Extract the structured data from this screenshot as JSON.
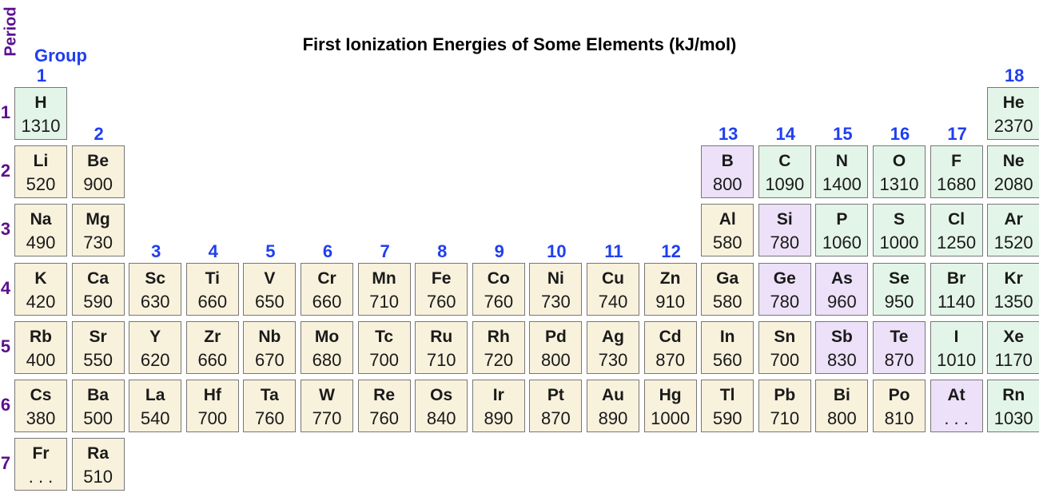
{
  "title": "First Ionization Energies of Some Elements (kJ/mol)",
  "period_label": "Period",
  "group_label": "Group",
  "colors": {
    "metal": "#f8f1dc",
    "nonmetal": "#e3f5e8",
    "metalloid": "#ece1f8",
    "group_number": "#1f3ff0",
    "period_number": "#5b0f8f"
  },
  "groups": [
    {
      "label": "1",
      "col": 1,
      "row": 1
    },
    {
      "label": "2",
      "col": 2,
      "row": 2
    },
    {
      "label": "3",
      "col": 3,
      "row": 4
    },
    {
      "label": "4",
      "col": 4,
      "row": 4
    },
    {
      "label": "5",
      "col": 5,
      "row": 4
    },
    {
      "label": "6",
      "col": 6,
      "row": 4
    },
    {
      "label": "7",
      "col": 7,
      "row": 4
    },
    {
      "label": "8",
      "col": 8,
      "row": 4
    },
    {
      "label": "9",
      "col": 9,
      "row": 4
    },
    {
      "label": "10",
      "col": 10,
      "row": 4
    },
    {
      "label": "11",
      "col": 11,
      "row": 4
    },
    {
      "label": "12",
      "col": 12,
      "row": 4
    },
    {
      "label": "13",
      "col": 13,
      "row": 2
    },
    {
      "label": "14",
      "col": 14,
      "row": 2
    },
    {
      "label": "15",
      "col": 15,
      "row": 2
    },
    {
      "label": "16",
      "col": 16,
      "row": 2
    },
    {
      "label": "17",
      "col": 17,
      "row": 2
    },
    {
      "label": "18",
      "col": 18,
      "row": 1
    }
  ],
  "periods": [
    "1",
    "2",
    "3",
    "4",
    "5",
    "6",
    "7"
  ],
  "elements": [
    {
      "symbol": "H",
      "value": "1310",
      "period": 1,
      "col": 1,
      "type": "nonmetal"
    },
    {
      "symbol": "He",
      "value": "2370",
      "period": 1,
      "col": 18,
      "type": "nonmetal"
    },
    {
      "symbol": "Li",
      "value": "520",
      "period": 2,
      "col": 1,
      "type": "metal"
    },
    {
      "symbol": "Be",
      "value": "900",
      "period": 2,
      "col": 2,
      "type": "metal"
    },
    {
      "symbol": "B",
      "value": "800",
      "period": 2,
      "col": 13,
      "type": "metalloid"
    },
    {
      "symbol": "C",
      "value": "1090",
      "period": 2,
      "col": 14,
      "type": "nonmetal"
    },
    {
      "symbol": "N",
      "value": "1400",
      "period": 2,
      "col": 15,
      "type": "nonmetal"
    },
    {
      "symbol": "O",
      "value": "1310",
      "period": 2,
      "col": 16,
      "type": "nonmetal"
    },
    {
      "symbol": "F",
      "value": "1680",
      "period": 2,
      "col": 17,
      "type": "nonmetal"
    },
    {
      "symbol": "Ne",
      "value": "2080",
      "period": 2,
      "col": 18,
      "type": "nonmetal"
    },
    {
      "symbol": "Na",
      "value": "490",
      "period": 3,
      "col": 1,
      "type": "metal"
    },
    {
      "symbol": "Mg",
      "value": "730",
      "period": 3,
      "col": 2,
      "type": "metal"
    },
    {
      "symbol": "Al",
      "value": "580",
      "period": 3,
      "col": 13,
      "type": "metal"
    },
    {
      "symbol": "Si",
      "value": "780",
      "period": 3,
      "col": 14,
      "type": "metalloid"
    },
    {
      "symbol": "P",
      "value": "1060",
      "period": 3,
      "col": 15,
      "type": "nonmetal"
    },
    {
      "symbol": "S",
      "value": "1000",
      "period": 3,
      "col": 16,
      "type": "nonmetal"
    },
    {
      "symbol": "Cl",
      "value": "1250",
      "period": 3,
      "col": 17,
      "type": "nonmetal"
    },
    {
      "symbol": "Ar",
      "value": "1520",
      "period": 3,
      "col": 18,
      "type": "nonmetal"
    },
    {
      "symbol": "K",
      "value": "420",
      "period": 4,
      "col": 1,
      "type": "metal"
    },
    {
      "symbol": "Ca",
      "value": "590",
      "period": 4,
      "col": 2,
      "type": "metal"
    },
    {
      "symbol": "Sc",
      "value": "630",
      "period": 4,
      "col": 3,
      "type": "metal"
    },
    {
      "symbol": "Ti",
      "value": "660",
      "period": 4,
      "col": 4,
      "type": "metal"
    },
    {
      "symbol": "V",
      "value": "650",
      "period": 4,
      "col": 5,
      "type": "metal"
    },
    {
      "symbol": "Cr",
      "value": "660",
      "period": 4,
      "col": 6,
      "type": "metal"
    },
    {
      "symbol": "Mn",
      "value": "710",
      "period": 4,
      "col": 7,
      "type": "metal"
    },
    {
      "symbol": "Fe",
      "value": "760",
      "period": 4,
      "col": 8,
      "type": "metal"
    },
    {
      "symbol": "Co",
      "value": "760",
      "period": 4,
      "col": 9,
      "type": "metal"
    },
    {
      "symbol": "Ni",
      "value": "730",
      "period": 4,
      "col": 10,
      "type": "metal"
    },
    {
      "symbol": "Cu",
      "value": "740",
      "period": 4,
      "col": 11,
      "type": "metal"
    },
    {
      "symbol": "Zn",
      "value": "910",
      "period": 4,
      "col": 12,
      "type": "metal"
    },
    {
      "symbol": "Ga",
      "value": "580",
      "period": 4,
      "col": 13,
      "type": "metal"
    },
    {
      "symbol": "Ge",
      "value": "780",
      "period": 4,
      "col": 14,
      "type": "metalloid"
    },
    {
      "symbol": "As",
      "value": "960",
      "period": 4,
      "col": 15,
      "type": "metalloid"
    },
    {
      "symbol": "Se",
      "value": "950",
      "period": 4,
      "col": 16,
      "type": "nonmetal"
    },
    {
      "symbol": "Br",
      "value": "1140",
      "period": 4,
      "col": 17,
      "type": "nonmetal"
    },
    {
      "symbol": "Kr",
      "value": "1350",
      "period": 4,
      "col": 18,
      "type": "nonmetal"
    },
    {
      "symbol": "Rb",
      "value": "400",
      "period": 5,
      "col": 1,
      "type": "metal"
    },
    {
      "symbol": "Sr",
      "value": "550",
      "period": 5,
      "col": 2,
      "type": "metal"
    },
    {
      "symbol": "Y",
      "value": "620",
      "period": 5,
      "col": 3,
      "type": "metal"
    },
    {
      "symbol": "Zr",
      "value": "660",
      "period": 5,
      "col": 4,
      "type": "metal"
    },
    {
      "symbol": "Nb",
      "value": "670",
      "period": 5,
      "col": 5,
      "type": "metal"
    },
    {
      "symbol": "Mo",
      "value": "680",
      "period": 5,
      "col": 6,
      "type": "metal"
    },
    {
      "symbol": "Tc",
      "value": "700",
      "period": 5,
      "col": 7,
      "type": "metal"
    },
    {
      "symbol": "Ru",
      "value": "710",
      "period": 5,
      "col": 8,
      "type": "metal"
    },
    {
      "symbol": "Rh",
      "value": "720",
      "period": 5,
      "col": 9,
      "type": "metal"
    },
    {
      "symbol": "Pd",
      "value": "800",
      "period": 5,
      "col": 10,
      "type": "metal"
    },
    {
      "symbol": "Ag",
      "value": "730",
      "period": 5,
      "col": 11,
      "type": "metal"
    },
    {
      "symbol": "Cd",
      "value": "870",
      "period": 5,
      "col": 12,
      "type": "metal"
    },
    {
      "symbol": "In",
      "value": "560",
      "period": 5,
      "col": 13,
      "type": "metal"
    },
    {
      "symbol": "Sn",
      "value": "700",
      "period": 5,
      "col": 14,
      "type": "metal"
    },
    {
      "symbol": "Sb",
      "value": "830",
      "period": 5,
      "col": 15,
      "type": "metalloid"
    },
    {
      "symbol": "Te",
      "value": "870",
      "period": 5,
      "col": 16,
      "type": "metalloid"
    },
    {
      "symbol": "I",
      "value": "1010",
      "period": 5,
      "col": 17,
      "type": "nonmetal"
    },
    {
      "symbol": "Xe",
      "value": "1170",
      "period": 5,
      "col": 18,
      "type": "nonmetal"
    },
    {
      "symbol": "Cs",
      "value": "380",
      "period": 6,
      "col": 1,
      "type": "metal"
    },
    {
      "symbol": "Ba",
      "value": "500",
      "period": 6,
      "col": 2,
      "type": "metal"
    },
    {
      "symbol": "La",
      "value": "540",
      "period": 6,
      "col": 3,
      "type": "metal"
    },
    {
      "symbol": "Hf",
      "value": "700",
      "period": 6,
      "col": 4,
      "type": "metal"
    },
    {
      "symbol": "Ta",
      "value": "760",
      "period": 6,
      "col": 5,
      "type": "metal"
    },
    {
      "symbol": "W",
      "value": "770",
      "period": 6,
      "col": 6,
      "type": "metal"
    },
    {
      "symbol": "Re",
      "value": "760",
      "period": 6,
      "col": 7,
      "type": "metal"
    },
    {
      "symbol": "Os",
      "value": "840",
      "period": 6,
      "col": 8,
      "type": "metal"
    },
    {
      "symbol": "Ir",
      "value": "890",
      "period": 6,
      "col": 9,
      "type": "metal"
    },
    {
      "symbol": "Pt",
      "value": "870",
      "period": 6,
      "col": 10,
      "type": "metal"
    },
    {
      "symbol": "Au",
      "value": "890",
      "period": 6,
      "col": 11,
      "type": "metal"
    },
    {
      "symbol": "Hg",
      "value": "1000",
      "period": 6,
      "col": 12,
      "type": "metal"
    },
    {
      "symbol": "Tl",
      "value": "590",
      "period": 6,
      "col": 13,
      "type": "metal"
    },
    {
      "symbol": "Pb",
      "value": "710",
      "period": 6,
      "col": 14,
      "type": "metal"
    },
    {
      "symbol": "Bi",
      "value": "800",
      "period": 6,
      "col": 15,
      "type": "metal"
    },
    {
      "symbol": "Po",
      "value": "810",
      "period": 6,
      "col": 16,
      "type": "metal"
    },
    {
      "symbol": "At",
      "value": ". . .",
      "period": 6,
      "col": 17,
      "type": "metalloid"
    },
    {
      "symbol": "Rn",
      "value": "1030",
      "period": 6,
      "col": 18,
      "type": "nonmetal"
    },
    {
      "symbol": "Fr",
      "value": ". . .",
      "period": 7,
      "col": 1,
      "type": "metal"
    },
    {
      "symbol": "Ra",
      "value": "510",
      "period": 7,
      "col": 2,
      "type": "metal"
    }
  ]
}
